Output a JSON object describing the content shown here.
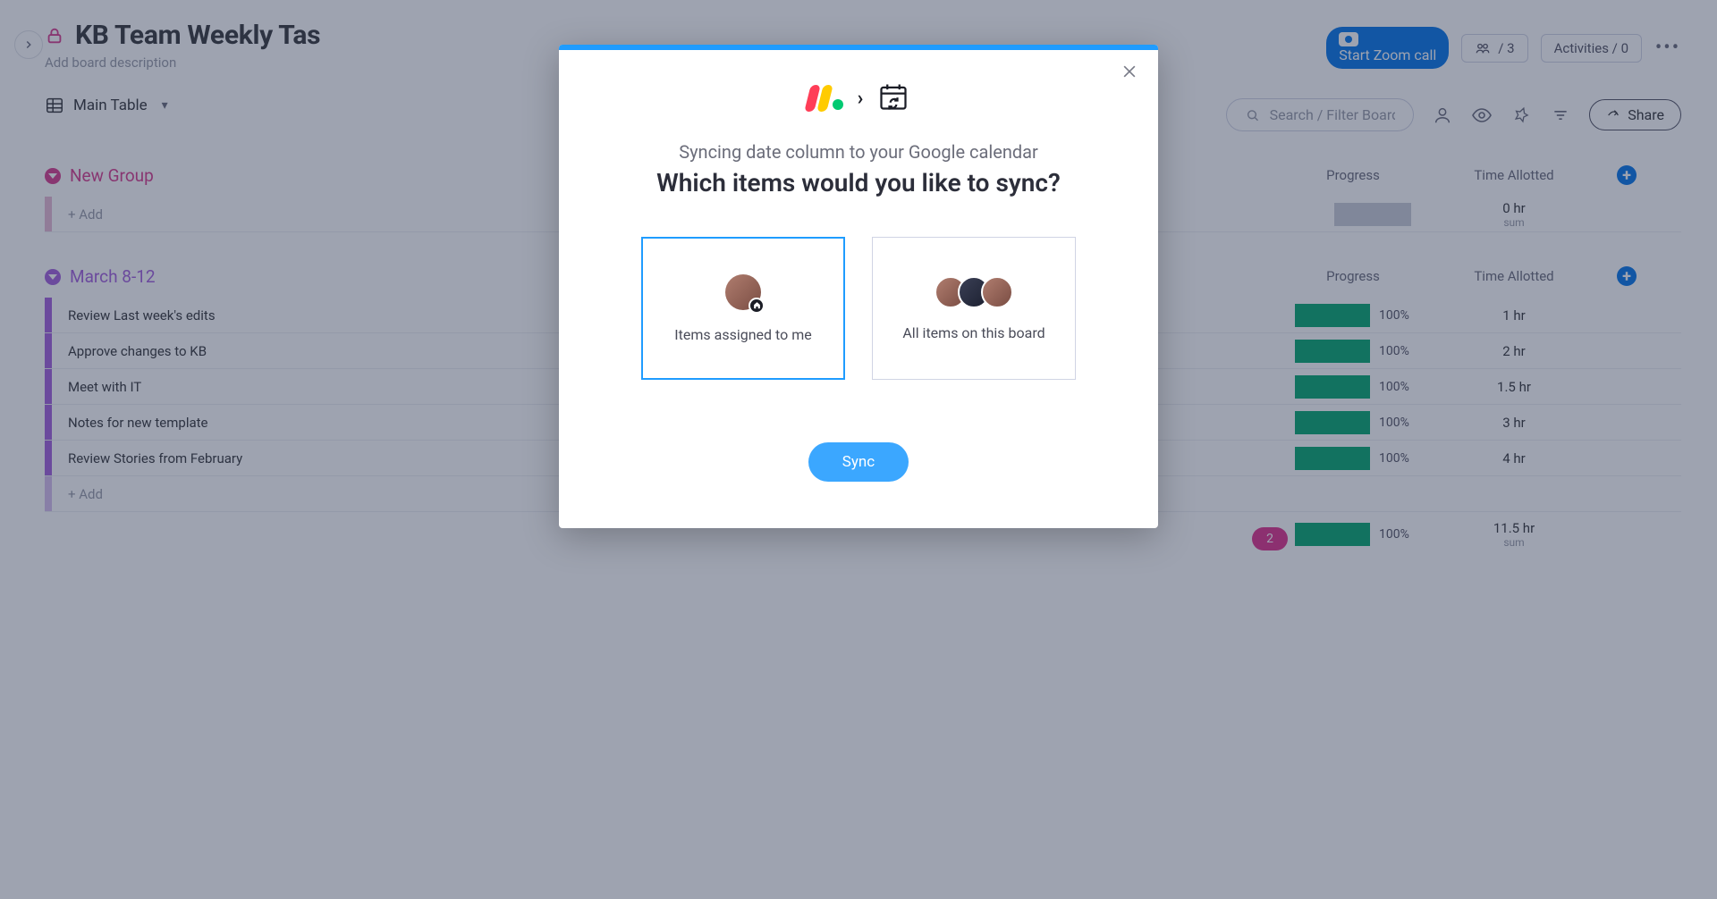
{
  "board": {
    "title": "KB Team Weekly Tas",
    "descPlaceholder": "Add board description",
    "mainView": "Main Table"
  },
  "topbar": {
    "zoom": "Start Zoom call",
    "people": " / 3",
    "activities": "Activities / 0"
  },
  "searchPlaceholder": "Search / Filter Board",
  "shareLabel": "Share",
  "columns": {
    "progress": "Progress",
    "time": "Time Allotted"
  },
  "groups": {
    "newGroup": {
      "name": "New Group",
      "add": "+ Add",
      "sumTime": "0 hr",
      "sumLabel": "sum"
    },
    "march": {
      "name": "March 8-12",
      "add": "+ Add",
      "items": [
        {
          "title": "Review Last week's edits",
          "progress": "100%",
          "time": "1 hr"
        },
        {
          "title": "Approve changes to KB",
          "progress": "100%",
          "time": "2 hr"
        },
        {
          "title": "Meet with IT",
          "progress": "100%",
          "time": "1.5 hr"
        },
        {
          "title": "Notes for new template",
          "progress": "100%",
          "time": "3 hr"
        },
        {
          "title": "Review Stories from February",
          "progress": "100%",
          "time": "4 hr"
        }
      ],
      "sumProgress": "100%",
      "sumTime": "11.5 hr",
      "sumLabel": "sum",
      "badge": "2"
    }
  },
  "modal": {
    "subtitle": "Syncing date column to your Google calendar",
    "heading": "Which items would you like to sync?",
    "optMe": "Items assigned to me",
    "optAll": "All items on this board",
    "syncBtn": "Sync"
  }
}
